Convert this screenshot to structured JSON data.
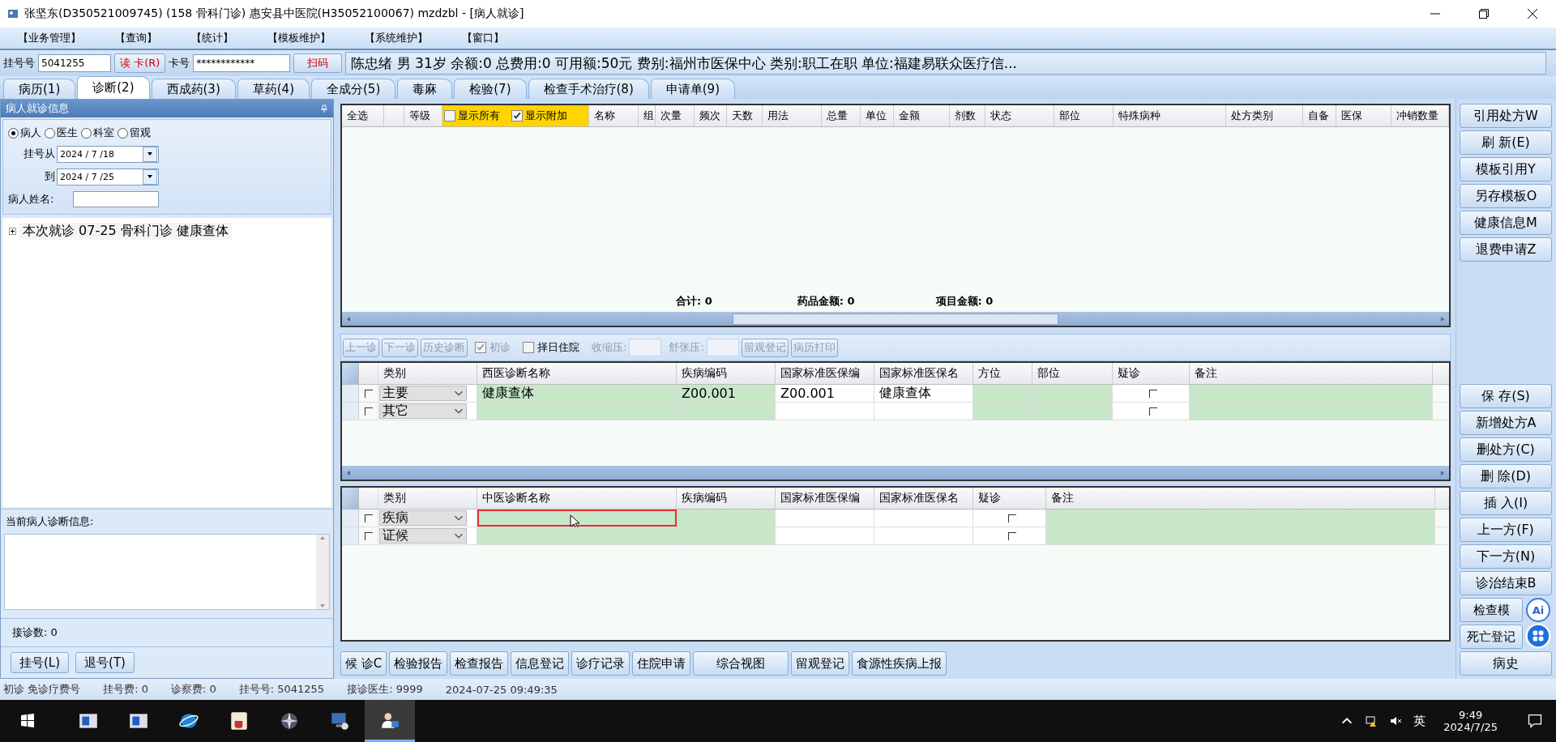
{
  "window": {
    "title": "张坚东(D350521009745) (158 骨科门诊) 惠安县中医院(H35052100067) mzdzbl - [病人就诊]"
  },
  "menu": [
    "【业务管理】",
    "【查询】",
    "【统计】",
    "【模板维护】",
    "【系统维护】",
    "【窗口】"
  ],
  "patient_bar": {
    "reg_label": "挂号号",
    "reg_value": "5041255",
    "read_card_button": "读 卡(R)",
    "card_label": "卡号",
    "card_value": "************",
    "scan_button": "扫码",
    "info": "陈忠绪 男 31岁 余额:0 总费用:0 可用额:50元 费别:福州市医保中心 类别:职工在职 单位:福建易联众医疗信..."
  },
  "tabs": [
    {
      "label": "病历(1)",
      "selected": false
    },
    {
      "label": "诊断(2)",
      "selected": true
    },
    {
      "label": "西成药(3)",
      "selected": false
    },
    {
      "label": "草药(4)",
      "selected": false
    },
    {
      "label": "全成分(5)",
      "selected": false
    },
    {
      "label": "毒麻",
      "selected": false
    },
    {
      "label": "检验(7)",
      "selected": false
    },
    {
      "label": "检查手术治疗(8)",
      "selected": false
    },
    {
      "label": "申请单(9)",
      "selected": false
    }
  ],
  "left_panel": {
    "title": "病人就诊信息",
    "radios": [
      {
        "label": "病人",
        "selected": true
      },
      {
        "label": "医生",
        "selected": false
      },
      {
        "label": "科室",
        "selected": false
      },
      {
        "label": "留观",
        "selected": false
      }
    ],
    "date_from_label": "挂号从",
    "date_from": "2024 / 7 /18",
    "date_to_label": "到",
    "date_to": "2024 / 7 /25",
    "name_label": "病人姓名:",
    "tree": [
      {
        "label": "本次就诊 07-25 骨科门诊 健康查体",
        "expanded": false
      }
    ],
    "diagnosis_label": "当前病人诊断信息:",
    "count_label": "接诊数: 0",
    "buttons": [
      "挂号(L)",
      "退号(T)"
    ]
  },
  "order_grid": {
    "columns": [
      {
        "kind": "text",
        "label": "全选"
      },
      {
        "kind": "blank"
      },
      {
        "kind": "text",
        "label": "等级"
      },
      {
        "kind": "toggles",
        "items": [
          {
            "label": "显示所有",
            "checked": false
          },
          {
            "label": "显示附加",
            "checked": true
          }
        ]
      },
      {
        "kind": "text",
        "label": "名称"
      },
      {
        "kind": "text",
        "label": "组"
      },
      {
        "kind": "text",
        "label": "次量"
      },
      {
        "kind": "text",
        "label": "频次"
      },
      {
        "kind": "text",
        "label": "天数"
      },
      {
        "kind": "text",
        "label": "用法"
      },
      {
        "kind": "text",
        "label": "总量"
      },
      {
        "kind": "text",
        "label": "单位"
      },
      {
        "kind": "text",
        "label": "金额"
      },
      {
        "kind": "text",
        "label": "剂数"
      },
      {
        "kind": "text",
        "label": "状态"
      },
      {
        "kind": "text",
        "label": "部位"
      },
      {
        "kind": "text",
        "label": "特殊病种"
      },
      {
        "kind": "text",
        "label": "处方类别"
      },
      {
        "kind": "text",
        "label": "自备"
      },
      {
        "kind": "text",
        "label": "医保"
      },
      {
        "kind": "text",
        "label": "冲销数量"
      }
    ],
    "totals": [
      "合计: 0",
      "药品金额: 0",
      "项目金额: 0"
    ]
  },
  "diag_toolbar": [
    {
      "kind": "button",
      "label": "上一诊",
      "disabled": true
    },
    {
      "kind": "button",
      "label": "下一诊",
      "disabled": true
    },
    {
      "kind": "button",
      "label": "历史诊断",
      "disabled": true
    },
    {
      "kind": "check",
      "label": "初诊",
      "checked": true,
      "disabled": true
    },
    {
      "kind": "check",
      "label": "择日住院",
      "checked": false,
      "disabled": false
    },
    {
      "kind": "field",
      "label": "收缩压:"
    },
    {
      "kind": "field",
      "label": "舒张压:"
    },
    {
      "kind": "button",
      "label": "留观登记",
      "disabled": true
    },
    {
      "kind": "button",
      "label": "病历打印",
      "disabled": true
    }
  ],
  "western_grid": {
    "columns": [
      "类别",
      "西医诊断名称",
      "疾病编码",
      "国家标准医保编",
      "国家标准医保名",
      "方位",
      "部位",
      "疑诊",
      "备注"
    ],
    "rows": [
      {
        "checked": false,
        "category": "主要",
        "name": "健康查体",
        "code": "Z00.001",
        "insurance_code": "Z00.001",
        "insurance_name": "健康查体",
        "suspected": false
      },
      {
        "checked": false,
        "category": "其它",
        "suspected": false
      }
    ]
  },
  "tcm_grid": {
    "columns": [
      "类别",
      "中医诊断名称",
      "疾病编码",
      "国家标准医保编",
      "国家标准医保名",
      "疑诊",
      "备注"
    ],
    "rows": [
      {
        "checked": false,
        "category": "疾病",
        "suspected": false,
        "highlighted": true
      },
      {
        "checked": false,
        "category": "证候",
        "suspected": false,
        "highlighted": false
      }
    ]
  },
  "bottom_buttons": [
    "候 诊C",
    "检验报告",
    "检查报告",
    "信息登记",
    "诊疗记录",
    "住院申请",
    "综合视图",
    "留观登记",
    "食源性疾病上报"
  ],
  "right_buttons_top": [
    "引用处方W",
    "刷 新(E)",
    "模板引用Y",
    "另存模板O",
    "健康信息M",
    "退费申请Z"
  ],
  "right_buttons_bottom": [
    "保 存(S)",
    "新增处方A",
    "删处方(C)",
    "删 除(D)",
    "插 入(I)",
    "上一方(F)",
    "下一方(N)",
    "诊治结束B",
    "检查模",
    "死亡登记",
    "病史"
  ],
  "ai_widget": {
    "label": "Ai"
  },
  "status_bar": [
    "初诊 免诊疗费号",
    "挂号费: 0",
    "诊察费: 0",
    "挂号号: 5041255",
    "接诊医生: 9999",
    "2024-07-25 09:49:35"
  ],
  "taskbar": {
    "input_method": "英",
    "time": "9:49",
    "date": "2024/7/25",
    "apps": [
      {
        "selected": false
      },
      {
        "selected": false
      },
      {
        "selected": false
      },
      {
        "selected": false
      },
      {
        "selected": false
      },
      {
        "selected": false
      },
      {
        "selected": true
      }
    ]
  }
}
